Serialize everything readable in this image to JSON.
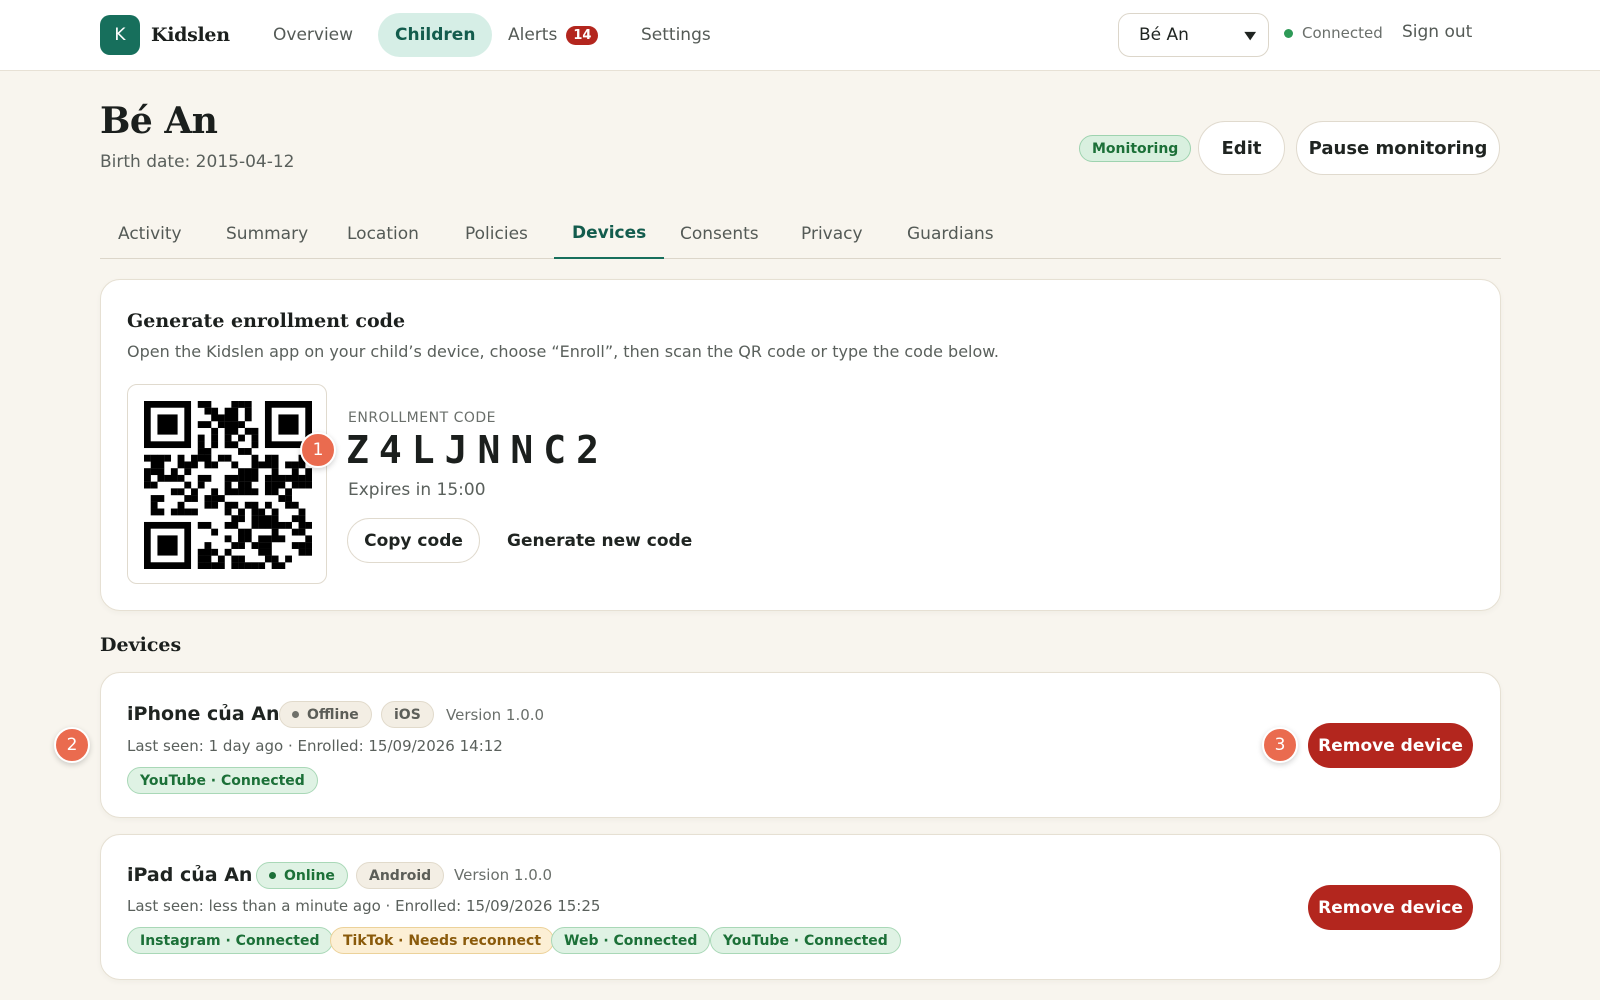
{
  "brand": {
    "initial": "K",
    "name": "Kidslen"
  },
  "nav": {
    "items": [
      {
        "label": "Overview"
      },
      {
        "label": "Children"
      },
      {
        "label": "Alerts",
        "badge": "14"
      },
      {
        "label": "Settings"
      }
    ],
    "child_select": "Bé An",
    "connection_status": "Connected",
    "sign_out": "Sign out"
  },
  "header": {
    "title": "Bé An",
    "birth_date": "Birth date: 2015-04-12",
    "status": "Monitoring",
    "edit_label": "Edit",
    "pause_label": "Pause monitoring"
  },
  "tabs": [
    "Activity",
    "Summary",
    "Location",
    "Policies",
    "Devices",
    "Consents",
    "Privacy",
    "Guardians"
  ],
  "active_tab": "Devices",
  "enrollment": {
    "title": "Generate enrollment code",
    "description": "Open the Kidslen app on your child’s device, choose “Enroll”, then scan the QR code or type the code below.",
    "code_label": "ENROLLMENT CODE",
    "code": "Z4LJNNC2",
    "expires": "Expires in 15:00",
    "copy_label": "Copy code",
    "generate_label": "Generate new code"
  },
  "devices_section": {
    "title": "Devices",
    "items": [
      {
        "name": "iPhone của An",
        "status": "Offline",
        "platform": "iOS",
        "version": "Version 1.0.0",
        "last_seen": "Last seen: 1 day ago · Enrolled: 15/09/2026 14:12",
        "connections": [
          "YouTube · Connected"
        ],
        "remove_label": "Remove device"
      },
      {
        "name": "iPad của An",
        "status": "Online",
        "platform": "Android",
        "version": "Version 1.0.0",
        "last_seen": "Last seen: less than a minute ago · Enrolled: 15/09/2026 15:25",
        "connections": [
          "Instagram · Connected",
          "TikTok · Needs reconnect",
          "Web · Connected",
          "YouTube · Connected"
        ],
        "remove_label": "Remove device"
      }
    ]
  },
  "markers": [
    "1",
    "2",
    "3"
  ],
  "colors": {
    "accent": "#176f5c",
    "danger": "#b3261e",
    "marker": "#ea6b4f",
    "background": "#f8f5ee"
  }
}
